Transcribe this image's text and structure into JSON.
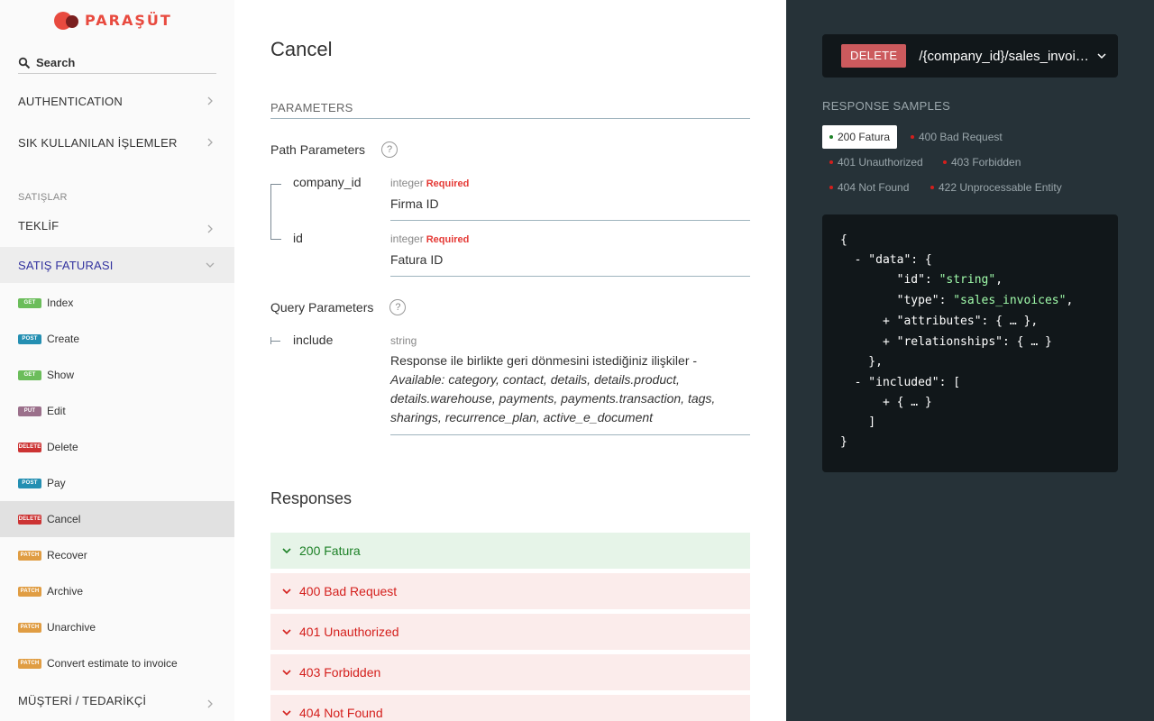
{
  "logo": {
    "text": "PARAŞÜT"
  },
  "search": {
    "placeholder": "Search"
  },
  "sidebar": {
    "sections": [
      {
        "label": "AUTHENTICATION"
      },
      {
        "label": "SIK KULLANILAN İŞLEMLER"
      }
    ],
    "group_label": "SATIŞLAR",
    "teklif": {
      "label": "TEKLİF"
    },
    "satis_faturasi": {
      "label": "SATIŞ FATURASI"
    },
    "operations": [
      {
        "method": "GET",
        "label": "Index",
        "color": "#6bbd5b"
      },
      {
        "method": "POST",
        "label": "Create",
        "color": "#248fb2"
      },
      {
        "method": "GET",
        "label": "Show",
        "color": "#6bbd5b"
      },
      {
        "method": "PUT",
        "label": "Edit",
        "color": "#9b708b"
      },
      {
        "method": "DELETE",
        "label": "Delete",
        "color": "#cc3333"
      },
      {
        "method": "POST",
        "label": "Pay",
        "color": "#248fb2"
      },
      {
        "method": "DELETE",
        "label": "Cancel",
        "color": "#cc3333"
      },
      {
        "method": "PATCH",
        "label": "Recover",
        "color": "#e09d43"
      },
      {
        "method": "PATCH",
        "label": "Archive",
        "color": "#e09d43"
      },
      {
        "method": "PATCH",
        "label": "Unarchive",
        "color": "#e09d43"
      },
      {
        "method": "PATCH",
        "label": "Convert estimate to invoice",
        "color": "#e09d43"
      }
    ],
    "musteri": {
      "label": "MÜŞTERİ / TEDARİKÇİ"
    }
  },
  "main": {
    "title": "Cancel",
    "parameters_header": "PARAMETERS",
    "path_params_title": "Path Parameters",
    "query_params_title": "Query Parameters",
    "help_glyph": "?",
    "path_params": [
      {
        "name": "company_id",
        "type": "integer",
        "required": "Required",
        "description": "Firma ID"
      },
      {
        "name": "id",
        "type": "integer",
        "required": "Required",
        "description": "Fatura ID"
      }
    ],
    "query_params": [
      {
        "name": "include",
        "type": "string",
        "description": "Response ile birlikte geri dönmesini istediğiniz ilişkiler - ",
        "available": "Available: category, contact, details, details.product, details.warehouse, payments, payments.transaction, tags, sharings, recurrence_plan, active_e_document"
      }
    ],
    "responses_title": "Responses",
    "responses": [
      {
        "label": "200 Fatura",
        "kind": "ok"
      },
      {
        "label": "400 Bad Request",
        "kind": "err"
      },
      {
        "label": "401 Unauthorized",
        "kind": "err"
      },
      {
        "label": "403 Forbidden",
        "kind": "err"
      },
      {
        "label": "404 Not Found",
        "kind": "err"
      }
    ]
  },
  "right": {
    "method": "DELETE",
    "path": "/{company_id}/sales_invoices/{id}/cancel",
    "samples_title": "RESPONSE SAMPLES",
    "tabs": [
      {
        "label": "200 Fatura",
        "dot_color": "#1d8127"
      },
      {
        "label": "400 Bad Request",
        "dot_color": "#d41f1c"
      },
      {
        "label": "401 Unauthorized",
        "dot_color": "#d41f1c"
      },
      {
        "label": "403 Forbidden",
        "dot_color": "#d41f1c"
      },
      {
        "label": "404 Not Found",
        "dot_color": "#d41f1c"
      },
      {
        "label": "422 Unprocessable Entity",
        "dot_color": "#d41f1c"
      }
    ],
    "code": {
      "l1": "{",
      "l2": "  - \"data\": {",
      "l3a": "        \"id\": ",
      "l3b": "\"string\"",
      "l3c": ",",
      "l4a": "        \"type\": ",
      "l4b": "\"sales_invoices\"",
      "l4c": ",",
      "l5": "      + \"attributes\": { … },",
      "l6": "      + \"relationships\": { … }",
      "l7": "    },",
      "l8": "  - \"included\": [",
      "l9": "      + { … }",
      "l10": "    ]",
      "l11": "}"
    }
  },
  "colors": {
    "accent": "#32329f",
    "brand": "#e84a3f",
    "ok": "#1d8127",
    "error": "#d41f1c",
    "right_panel_bg": "#263238"
  }
}
